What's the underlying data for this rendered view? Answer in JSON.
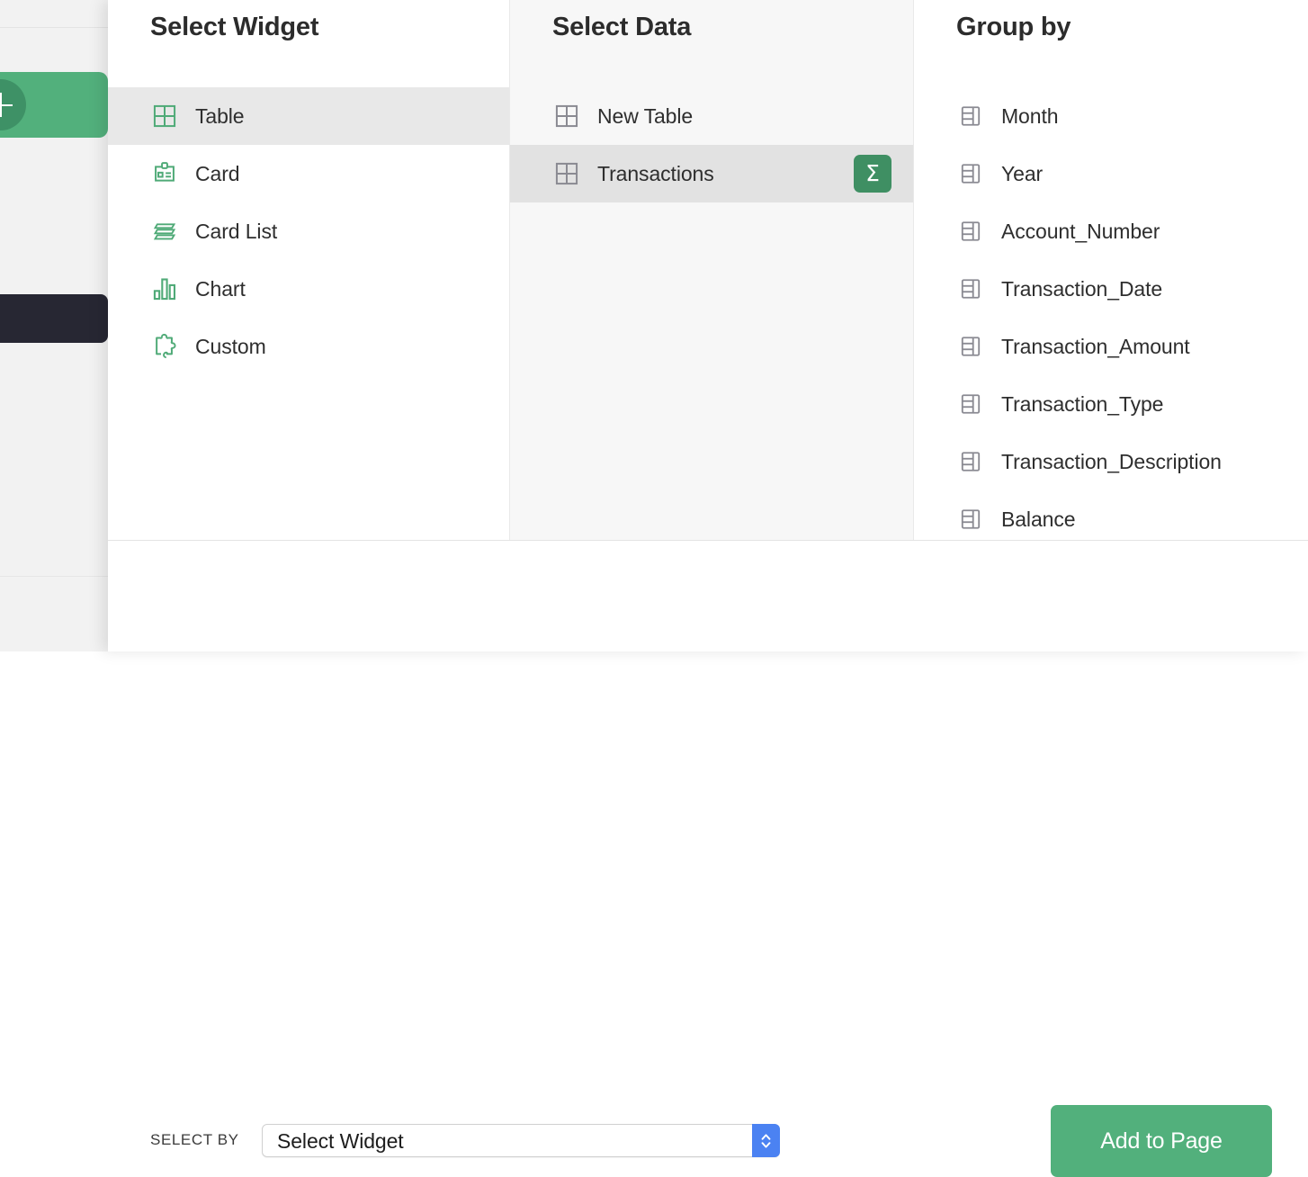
{
  "background": {
    "add_button_icon": "plus-icon",
    "add_card_color": "#52b07c",
    "add_circle_color": "#3e9166",
    "dark_block_color": "#272733"
  },
  "columns": {
    "widget": {
      "title": "Select Widget",
      "items": [
        {
          "label": "Table",
          "icon": "table-grid-icon",
          "selected": true
        },
        {
          "label": "Card",
          "icon": "id-card-icon",
          "selected": false
        },
        {
          "label": "Card List",
          "icon": "card-stack-icon",
          "selected": false
        },
        {
          "label": "Chart",
          "icon": "bar-chart-icon",
          "selected": false
        },
        {
          "label": "Custom",
          "icon": "puzzle-piece-icon",
          "selected": false
        }
      ]
    },
    "data": {
      "title": "Select Data",
      "items": [
        {
          "label": "New Table",
          "icon": "table-grid-icon",
          "selected": false,
          "badge": null
        },
        {
          "label": "Transactions",
          "icon": "table-grid-icon",
          "selected": true,
          "badge": "Σ"
        }
      ]
    },
    "group": {
      "title": "Group by",
      "items": [
        {
          "label": "Month",
          "icon": "column-field-icon"
        },
        {
          "label": "Year",
          "icon": "column-field-icon"
        },
        {
          "label": "Account_Number",
          "icon": "column-field-icon"
        },
        {
          "label": "Transaction_Date",
          "icon": "column-field-icon"
        },
        {
          "label": "Transaction_Amount",
          "icon": "column-field-icon"
        },
        {
          "label": "Transaction_Type",
          "icon": "column-field-icon"
        },
        {
          "label": "Transaction_Description",
          "icon": "column-field-icon"
        },
        {
          "label": "Balance",
          "icon": "column-field-icon"
        }
      ]
    }
  },
  "footer": {
    "select_by_label": "Select by",
    "select_value": "Select Widget",
    "select_options": [
      "Select Widget"
    ],
    "stepper_icon": "up-down-chevron-icon",
    "stepper_color": "#4b82f2",
    "add_button_label": "Add to Page",
    "add_button_color": "#52b07c"
  },
  "theme": {
    "accent_green": "#52b07c",
    "icon_green": "#4faa77",
    "icon_gray": "#8a8a92",
    "selected_widget_bg": "#e8e8e8",
    "selected_data_bg": "#e2e2e2"
  }
}
